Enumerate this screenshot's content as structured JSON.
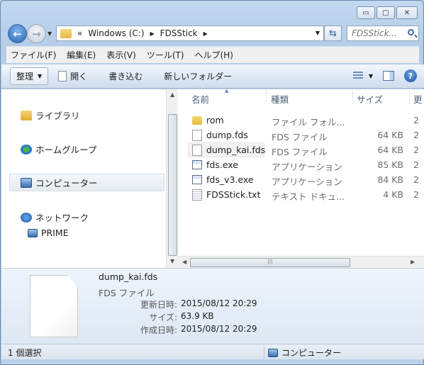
{
  "caption": {
    "minimize": "▭",
    "maximize": "▢",
    "close": "✕"
  },
  "address": {
    "overflow": "«",
    "crumbs": [
      "Windows (C:)",
      "FDSStick"
    ],
    "search_placeholder": "FDSStick..."
  },
  "menu": [
    "ファイル(F)",
    "編集(E)",
    "表示(V)",
    "ツール(T)",
    "ヘルプ(H)"
  ],
  "toolbar": {
    "organize": "整理",
    "open": "開く",
    "write": "書き込む",
    "new_folder": "新しいフォルダー",
    "help": "?"
  },
  "nav": {
    "libraries": "ライブラリ",
    "homegroup": "ホームグループ",
    "computer": "コンピューター",
    "network": "ネットワーク",
    "prime": "PRIME"
  },
  "columns": {
    "name": "名前",
    "type": "種類",
    "size": "サイズ",
    "date": "更"
  },
  "files": [
    {
      "name": "rom",
      "type": "ファイル フォル...",
      "size": "",
      "date": "2",
      "icon": "folder-icon"
    },
    {
      "name": "dump.fds",
      "type": "FDS ファイル",
      "size": "64 KB",
      "date": "2",
      "icon": "file-icon"
    },
    {
      "name": "dump_kai.fds",
      "type": "FDS ファイル",
      "size": "64 KB",
      "date": "2",
      "icon": "file-icon"
    },
    {
      "name": "fds.exe",
      "type": "アプリケーション",
      "size": "85 KB",
      "date": "2",
      "icon": "exe-icon"
    },
    {
      "name": "fds_v3.exe",
      "type": "アプリケーション",
      "size": "84 KB",
      "date": "2",
      "icon": "exe-icon"
    },
    {
      "name": "FDSStick.txt",
      "type": "テキスト ドキュ...",
      "size": "4 KB",
      "date": "2",
      "icon": "text-file-icon"
    }
  ],
  "details": {
    "name": "dump_kai.fds",
    "type": "FDS ファイル",
    "modified_label": "更新日時:",
    "modified": "2015/08/12 20:29",
    "size_label": "サイズ:",
    "size": "63.9 KB",
    "created_label": "作成日時:",
    "created": "2015/08/12 20:29"
  },
  "status": {
    "selected": "1 個選択",
    "location": "コンピューター"
  }
}
